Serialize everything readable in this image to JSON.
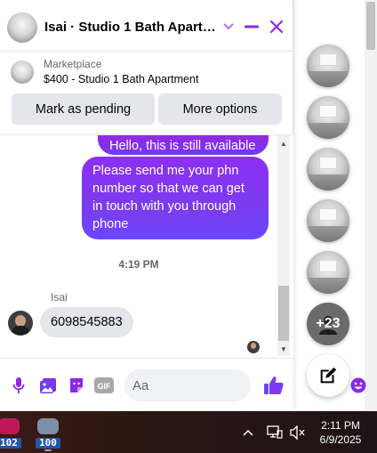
{
  "header": {
    "title": "Isai · Studio 1 Bath Apartm...",
    "chevron_icon": "chevron-down-icon",
    "minimize_icon": "minimize-icon",
    "close_icon": "close-icon",
    "accent_color": "#8a2be2"
  },
  "listing": {
    "category": "Marketplace",
    "title": "$400 - Studio 1 Bath Apartment",
    "mark_pending_label": "Mark as pending",
    "more_options_label": "More options"
  },
  "messages": {
    "partial_outgoing": "Hello, this is still available",
    "outgoing": "Please send me your phn number so that we can get in touch with you through phone",
    "timestamp": "4:19 PM",
    "sender_name": "Isai",
    "incoming": "6098545883"
  },
  "composer": {
    "placeholder": "Aa",
    "icons": [
      "microphone-icon",
      "photo-icon",
      "sticker-icon",
      "gif-icon",
      "emoji-icon",
      "thumbs-up-icon"
    ]
  },
  "side_bubbles": {
    "more_count": "+23",
    "compose_icon": "new-message-icon"
  },
  "taskbar": {
    "apps": [
      {
        "label": "102",
        "color": "#c2185b"
      },
      {
        "label": "100",
        "color": "#7b8fa6"
      }
    ],
    "tray_icons": [
      "chevron-up-icon",
      "network-icon",
      "volume-muted-icon"
    ],
    "time": "2:11 PM",
    "date": "6/9/2025"
  }
}
